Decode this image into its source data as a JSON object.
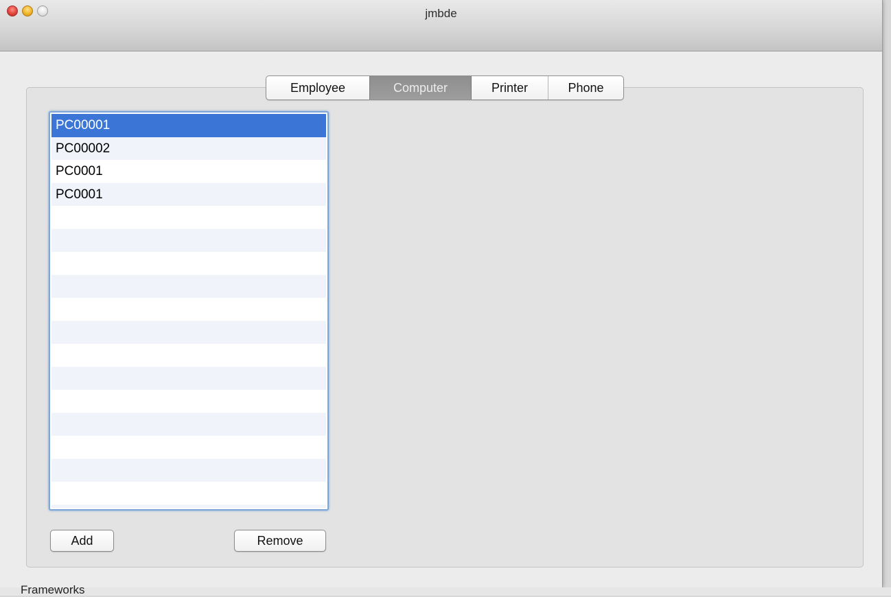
{
  "window": {
    "title": "jmbde"
  },
  "tabs": [
    {
      "label": "Employee",
      "active": false
    },
    {
      "label": "Computer",
      "active": true
    },
    {
      "label": "Printer",
      "active": false
    },
    {
      "label": "Phone",
      "active": false
    }
  ],
  "computer_list": {
    "items": [
      {
        "label": "PC00001",
        "selected": true
      },
      {
        "label": "PC00002",
        "selected": false
      },
      {
        "label": "PC0001",
        "selected": false
      },
      {
        "label": "PC0001",
        "selected": false
      }
    ]
  },
  "buttons": {
    "add_label": "Add",
    "remove_label": "Remove"
  },
  "background": {
    "partial_text": "Frameworks"
  },
  "colors": {
    "selection": "#3b76d6",
    "active_tab": "#969696"
  }
}
